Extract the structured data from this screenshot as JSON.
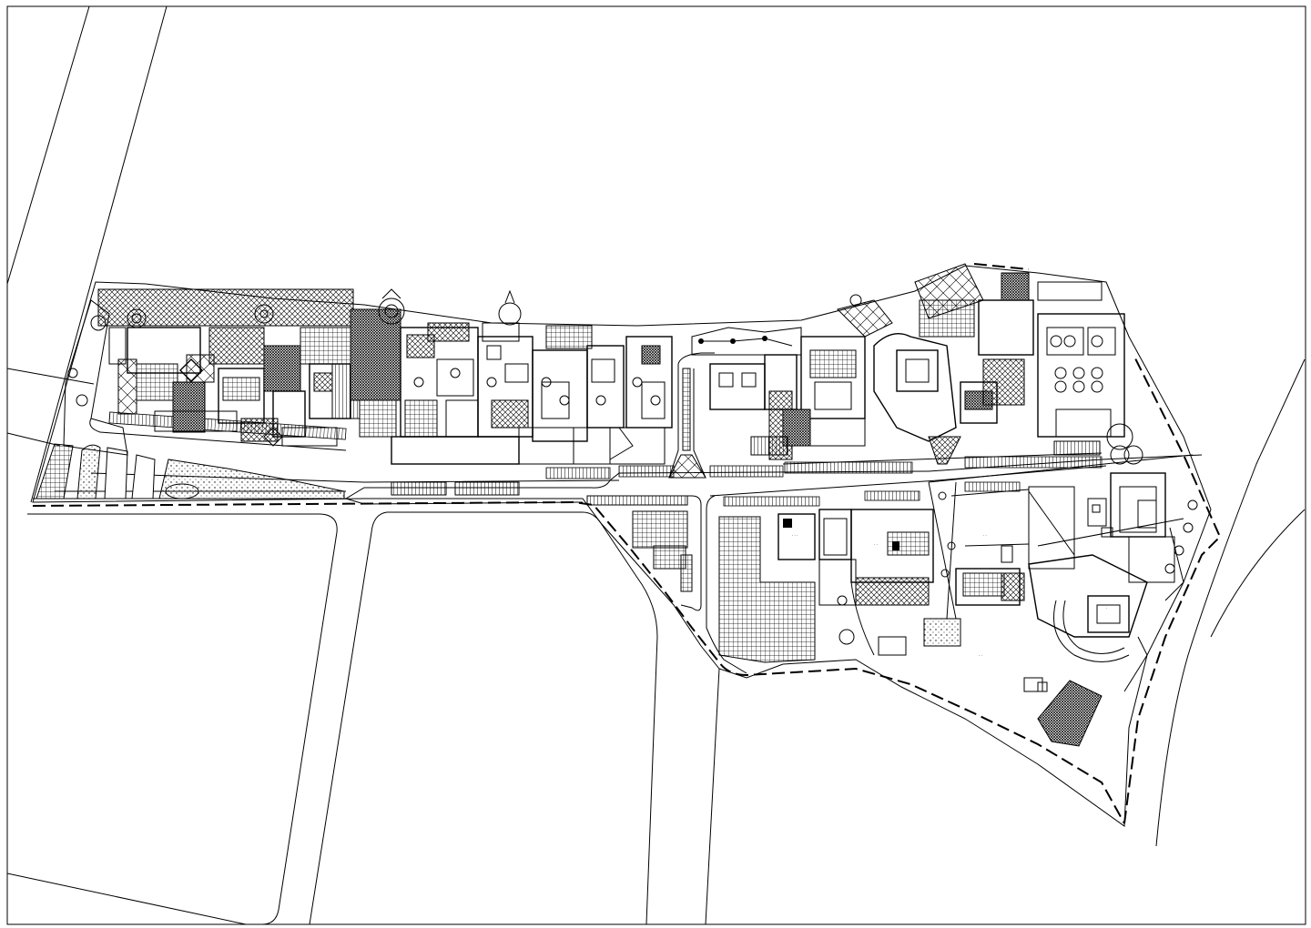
{
  "drawing": {
    "kind": "site plan",
    "line_color": "#000000",
    "background_color": "#ffffff"
  },
  "labels": []
}
